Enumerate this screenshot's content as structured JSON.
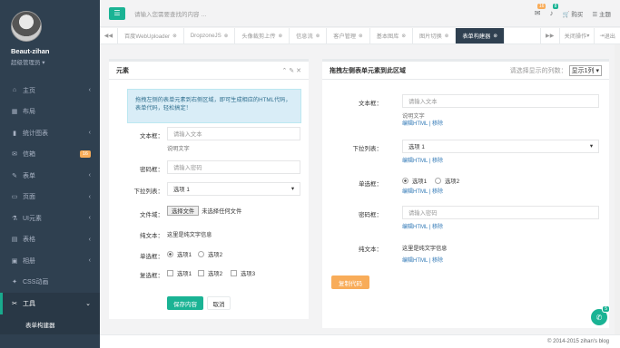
{
  "user": {
    "name": "Beaut-zihan",
    "role": "超级管理员"
  },
  "menu": [
    {
      "label": "主页",
      "icon": "home-icon",
      "glyph": "⌂",
      "arrow": "‹"
    },
    {
      "label": "布局",
      "icon": "layout-icon",
      "glyph": "▦",
      "arrow": ""
    },
    {
      "label": "统计图表",
      "icon": "chart-icon",
      "glyph": "▮",
      "arrow": "‹"
    },
    {
      "label": "信箱",
      "icon": "mail-icon",
      "glyph": "✉",
      "badge": "16"
    },
    {
      "label": "表单",
      "icon": "edit-icon",
      "glyph": "✎",
      "arrow": "‹"
    },
    {
      "label": "页面",
      "icon": "desktop-icon",
      "glyph": "▭",
      "arrow": "‹"
    },
    {
      "label": "UI元素",
      "icon": "flask-icon",
      "glyph": "⚗",
      "arrow": "‹"
    },
    {
      "label": "表格",
      "icon": "table-icon",
      "glyph": "▤",
      "arrow": "‹"
    },
    {
      "label": "相册",
      "icon": "picture-icon",
      "glyph": "▣",
      "arrow": "‹"
    },
    {
      "label": "CSS动画",
      "icon": "magic-icon",
      "glyph": "✦",
      "arrow": ""
    },
    {
      "label": "工具",
      "icon": "tool-icon",
      "glyph": "✂",
      "arrow": "⌄"
    }
  ],
  "submenu": "表单构建器",
  "topbar": {
    "search_placeholder": "请输入您需要查找的内容 …",
    "mail_badge": "16",
    "bell_badge": "8",
    "buy": "购买",
    "theme": "主题"
  },
  "tabs": [
    "百度WebUploader",
    "DropzoneJS",
    "头像裁剪上传",
    "信息流",
    "客户管理",
    "基本图库",
    "图片切换",
    "表单构建器"
  ],
  "tab_actions": {
    "close": "关闭操作",
    "logout": "退出"
  },
  "left_panel": {
    "title": "元素",
    "alert": "拖拽左侧的表单元素到右侧区域，即可生成相应的HTML代码，表单代码，轻松搞定！",
    "text_label": "文本框：",
    "text_placeholder": "请输入文本",
    "text_help": "说明文字",
    "pwd_label": "密码框：",
    "pwd_placeholder": "请输入密码",
    "select_label": "下拉列表：",
    "select_value": "选项 1",
    "file_label": "文件域：",
    "file_button": "选择文件",
    "file_none": "未选择任何文件",
    "static_label": "纯文本：",
    "static_value": "这里是纯文字信息",
    "radio_label": "单选框：",
    "radio_options": [
      "选项1",
      "选项2"
    ],
    "check_label": "复选框：",
    "check_options": [
      "选项1",
      "选项2",
      "选项3"
    ],
    "save": "保存内容",
    "cancel": "取消"
  },
  "right_panel": {
    "title": "拖拽左侧表单元素到此区域",
    "cols_label": "请选择显示的列数：",
    "cols_value": "显示1列",
    "text_label": "文本框：",
    "text_placeholder": "请输入文本",
    "text_help": "说明文字",
    "select_label": "下拉列表：",
    "select_value": "选项 1",
    "radio_label": "单选框：",
    "radio_options": [
      "选项1",
      "选项2"
    ],
    "pwd_label": "密码框：",
    "pwd_placeholder": "请输入密码",
    "static_label": "纯文本：",
    "static_value": "这里是纯文字信息",
    "edit": "编辑HTML",
    "sep": "|",
    "remove": "移除",
    "copy_button": "复制代码"
  },
  "footer": "© 2014-2015 zihan's blog",
  "chat_badge": "5",
  "colors": {
    "accent": "#1ab394",
    "sidebar": "#2f4050",
    "warning": "#f8ac59"
  }
}
